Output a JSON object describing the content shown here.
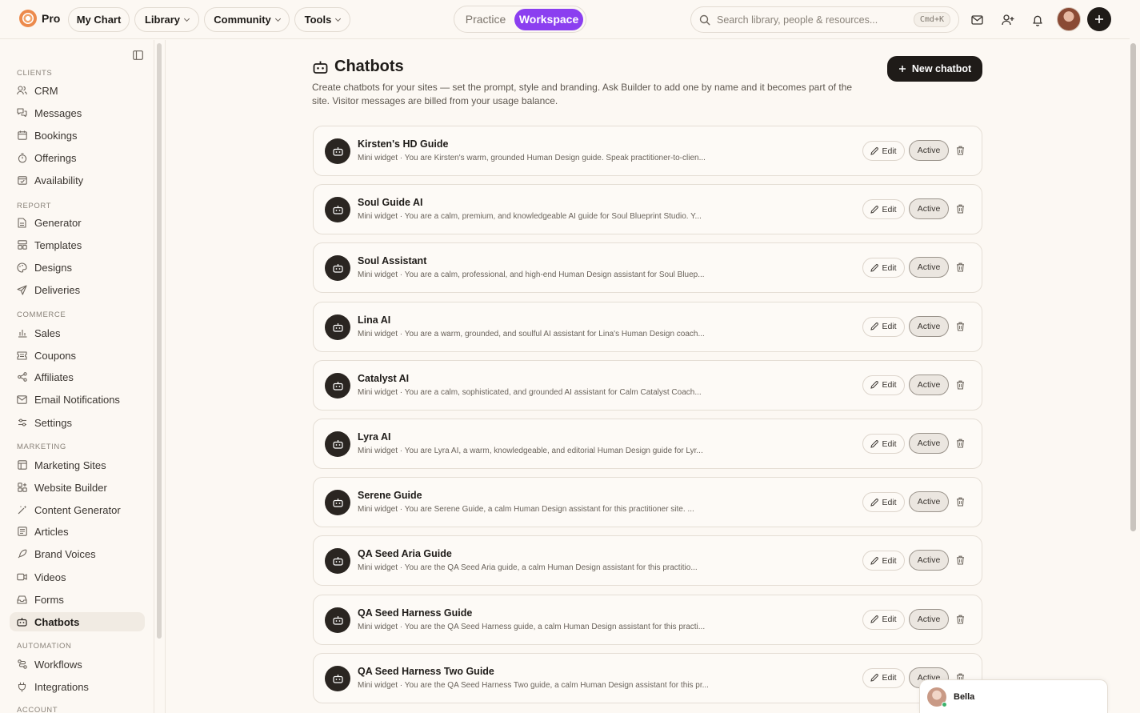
{
  "topbar": {
    "brand": "Pro",
    "nav": [
      {
        "label": "My Chart",
        "dropdown": false
      },
      {
        "label": "Library",
        "dropdown": true
      },
      {
        "label": "Community",
        "dropdown": true
      },
      {
        "label": "Tools",
        "dropdown": true
      }
    ],
    "mode": {
      "practice": "Practice",
      "workspace": "Workspace",
      "selected": "Workspace"
    },
    "search": {
      "placeholder": "Search library, people & resources...",
      "shortcut": "Cmd+K"
    }
  },
  "sidebar": {
    "sections": [
      {
        "title": "CLIENTS",
        "items": [
          "CRM",
          "Messages",
          "Bookings",
          "Offerings",
          "Availability"
        ]
      },
      {
        "title": "REPORT",
        "items": [
          "Generator",
          "Templates",
          "Designs",
          "Deliveries"
        ]
      },
      {
        "title": "COMMERCE",
        "items": [
          "Sales",
          "Coupons",
          "Affiliates",
          "Email Notifications",
          "Settings"
        ]
      },
      {
        "title": "MARKETING",
        "items": [
          "Marketing Sites",
          "Website Builder",
          "Content Generator",
          "Articles",
          "Brand Voices",
          "Videos",
          "Forms",
          "Chatbots"
        ]
      },
      {
        "title": "AUTOMATION",
        "items": [
          "Workflows",
          "Integrations"
        ]
      },
      {
        "title": "ACCOUNT",
        "items": []
      }
    ],
    "active": "Chatbots"
  },
  "page": {
    "title": "Chatbots",
    "description": "Create chatbots for your sites — set the prompt, style and branding. Ask Builder to add one by name and it becomes part of the site. Visitor messages are billed from your usage balance.",
    "new_button": "New chatbot"
  },
  "chatbots": [
    {
      "name": "Kirsten's HD Guide",
      "desc": "Mini widget · You are Kirsten's warm, grounded Human Design guide. Speak practitioner-to-clien...",
      "edit": "Edit",
      "status": "Active"
    },
    {
      "name": "Soul Guide AI",
      "desc": "Mini widget · You are a calm, premium, and knowledgeable AI guide for Soul Blueprint Studio. Y...",
      "edit": "Edit",
      "status": "Active"
    },
    {
      "name": "Soul Assistant",
      "desc": "Mini widget · You are a calm, professional, and high-end Human Design assistant for Soul Bluep...",
      "edit": "Edit",
      "status": "Active"
    },
    {
      "name": "Lina AI",
      "desc": "Mini widget · You are a warm, grounded, and soulful AI assistant for Lina's Human Design coach...",
      "edit": "Edit",
      "status": "Active"
    },
    {
      "name": "Catalyst AI",
      "desc": "Mini widget · You are a calm, sophisticated, and grounded AI assistant for Calm Catalyst Coach...",
      "edit": "Edit",
      "status": "Active"
    },
    {
      "name": "Lyra AI",
      "desc": "Mini widget · You are Lyra AI, a warm, knowledgeable, and editorial Human Design guide for Lyr...",
      "edit": "Edit",
      "status": "Active"
    },
    {
      "name": "Serene Guide",
      "desc": "Mini widget · You are Serene Guide, a calm Human Design assistant for this practitioner site. ...",
      "edit": "Edit",
      "status": "Active"
    },
    {
      "name": "QA Seed Aria Guide",
      "desc": "Mini widget · You are the QA Seed Aria guide, a calm Human Design assistant for this practitio...",
      "edit": "Edit",
      "status": "Active"
    },
    {
      "name": "QA Seed Harness Guide",
      "desc": "Mini widget · You are the QA Seed Harness guide, a calm Human Design assistant for this practi...",
      "edit": "Edit",
      "status": "Active"
    },
    {
      "name": "QA Seed Harness Two Guide",
      "desc": "Mini widget · You are the QA Seed Harness Two guide, a calm Human Design assistant for this pr...",
      "edit": "Edit",
      "status": "Active"
    }
  ],
  "presence": {
    "name": "Bella",
    "online": true
  },
  "colors": {
    "accent": "#8b3ff0",
    "dark": "#1f1b18",
    "background": "#fcf8f3",
    "online": "#3bb26b"
  }
}
